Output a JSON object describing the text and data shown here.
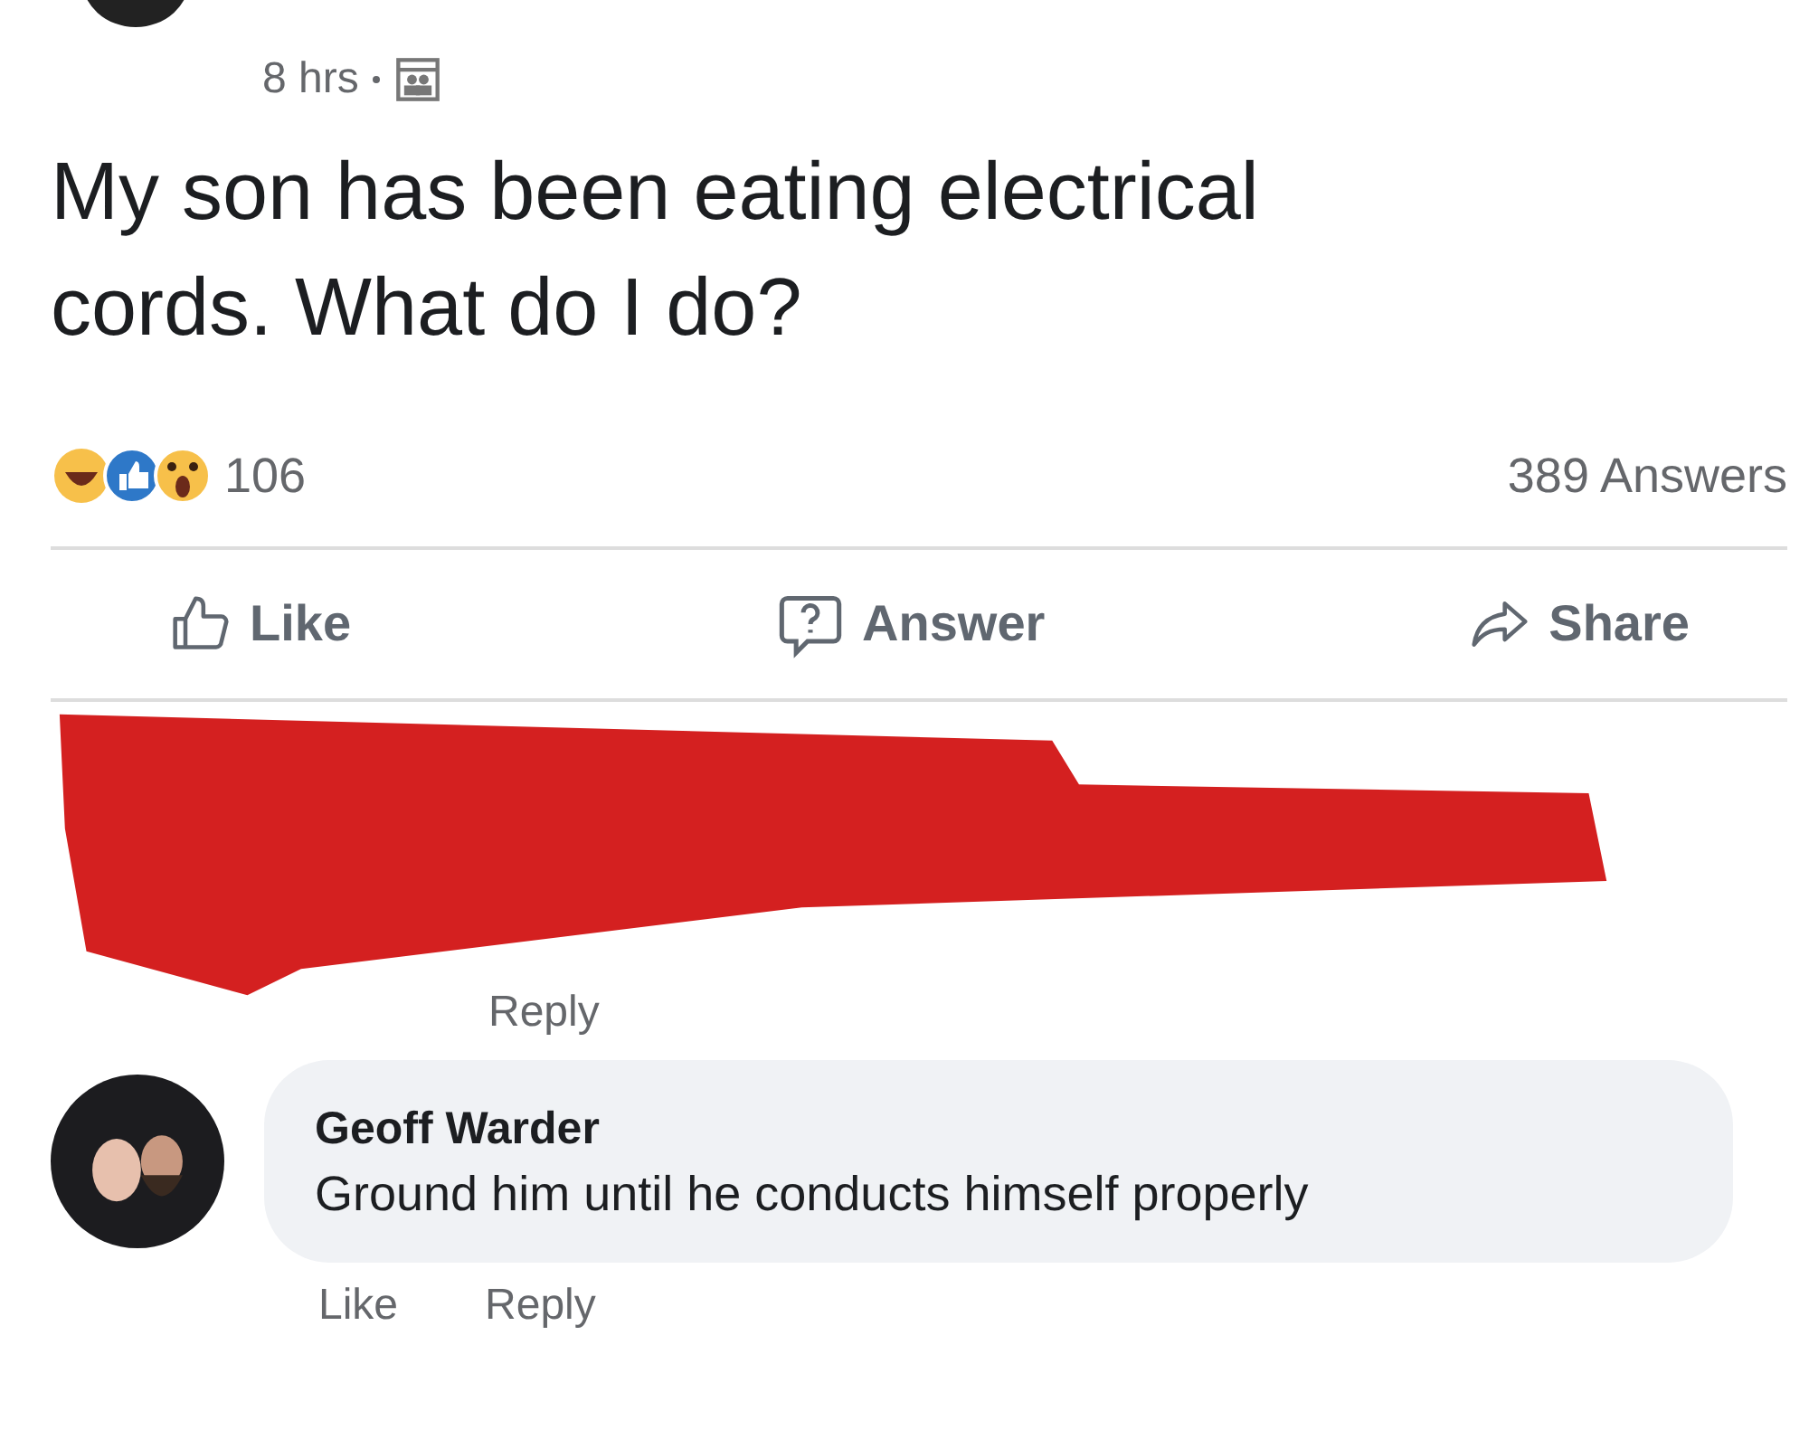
{
  "post": {
    "time": "8 hrs",
    "question": "My son has been eating electrical cords. What do I do?",
    "reaction_count": "106",
    "answers_count": "389 Answers",
    "actions": [
      {
        "kind": "like",
        "label": "Like"
      },
      {
        "kind": "answer",
        "label": "Answer"
      },
      {
        "kind": "share",
        "label": "Share"
      }
    ]
  },
  "comments": [
    {
      "redacted": true,
      "actions": [
        "Reply"
      ]
    },
    {
      "redacted": false,
      "author": "Geoff Warder",
      "text": "Ground him until he conducts himself properly",
      "actions": [
        "Like",
        "Reply"
      ]
    }
  ]
}
